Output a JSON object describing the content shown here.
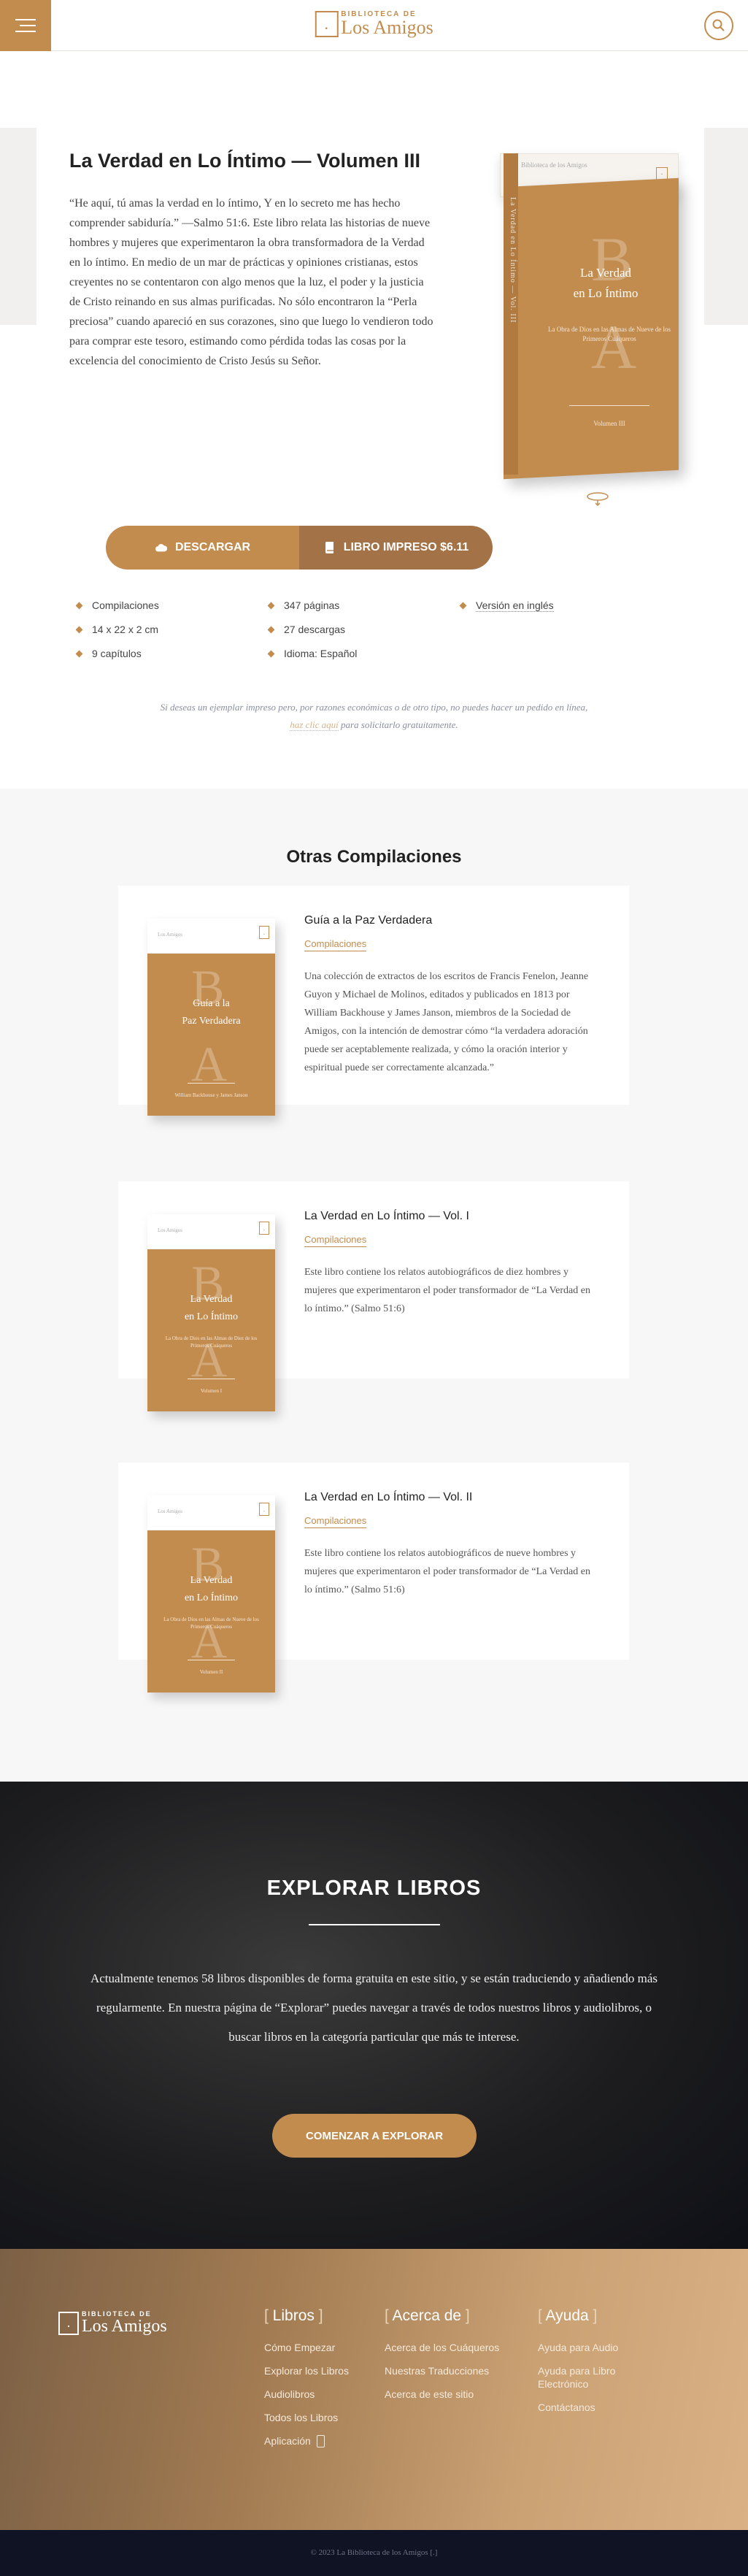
{
  "header": {
    "logo_small": "BIBLIOTECA DE",
    "logo_big": "Los Amigos",
    "logo_mark": "[.]",
    "icons": {
      "menu": "hamburger-icon",
      "search": "search-icon"
    }
  },
  "book": {
    "title": "La Verdad en Lo Íntimo — Volumen III",
    "description": "“He aquí, tú amas la verdad en lo íntimo, Y en lo secreto me has hecho comprender sabiduría.” —Salmo 51:6. Este libro relata las historias de nueve hombres y mujeres que experimentaron la obra transformadora de la Verdad en lo íntimo. En medio de un mar de prácticas y opiniones cristianas, estos creyentes no se contentaron con algo menos que la luz, el poder y la justicia de Cristo reinando en sus almas purificadas. No sólo encontraron la “Perla preciosa” cuando apareció en sus corazones, sino que luego lo vendieron todo para comprar este tesoro, estimando como pérdida todas las cosas por la excelencia del conocimiento de Cristo Jesús su Señor.",
    "cover": {
      "back_text": "Biblioteca de los Amigos",
      "spine": "La Verdad en Lo Íntimo — Vol. III",
      "letter_b": "B",
      "letter_a": "A",
      "title_line1": "La Verdad",
      "title_line2": "en Lo Íntimo",
      "subtitle": "La Obra de Dios en las Almas de Nueve de los Primeros Cuáqueros",
      "volume": "Volumen III"
    },
    "buttons": {
      "download": "DESCARGAR",
      "print": "LIBRO IMPRESO $6.11"
    },
    "meta": [
      "Compilaciones",
      "347 páginas",
      "Versión en inglés",
      "14 x 22 x 2 cm",
      "27 descargas",
      "9 capítulos",
      "Idioma: Español"
    ],
    "notice_before": "Si deseas un ejemplar impreso pero, por razones económicas o de otro tipo, no puedes hacer un pedido en línea,",
    "notice_link": "haz clic aquí",
    "notice_after": "para solicitarlo gratuitamente."
  },
  "related": {
    "title": "Otras Compilaciones",
    "items": [
      {
        "name": "Guía a la Paz Verdadera",
        "category": "Compilaciones",
        "cover_l1": "Guía a la",
        "cover_l2": "Paz Verdadera",
        "cover_sub": "",
        "cover_vol": "William Backhouse y James Janson",
        "description": "Una colección de extractos de los escritos de Francis Fenelon, Jeanne Guyon y Michael de Molinos, editados y publicados en 1813 por William Backhouse y James Janson, miembros de la Sociedad de Amigos, con la intención de demostrar cómo “la verdadera adoración puede ser aceptablemente realizada, y cómo la oración interior y espiritual puede ser correctamente alcanzada.”"
      },
      {
        "name": "La Verdad en Lo Íntimo — Vol. I",
        "category": "Compilaciones",
        "cover_l1": "La Verdad",
        "cover_l2": "en Lo Íntimo",
        "cover_sub": "La Obra de Dios en las Almas de Diez de los Primeros Cuáqueros",
        "cover_vol": "Volumen I",
        "description": "Este libro contiene los relatos autobiográficos de diez hombres y mujeres que experimentaron el poder transformador de “La Verdad en lo íntimo.” (Salmo 51:6)"
      },
      {
        "name": "La Verdad en Lo Íntimo — Vol. II",
        "category": "Compilaciones",
        "cover_l1": "La Verdad",
        "cover_l2": "en Lo Íntimo",
        "cover_sub": "La Obra de Dios en las Almas de Nueve de los Primeros Cuáqueros",
        "cover_vol": "Volumen II",
        "description": "Este libro contiene los relatos autobiográficos de nueve hombres y mujeres que experimentaron el poder transformador de “La Verdad en lo íntimo.” (Salmo 51:6)"
      }
    ]
  },
  "explore": {
    "title": "EXPLORAR LIBROS",
    "text": "Actualmente tenemos 58 libros disponibles de forma gratuita en este sitio, y se están traduciendo y añadiendo más regularmente. En nuestra página de “Explorar” puedes navegar a través de todos nuestros libros y audiolibros, o buscar libros en la categoría particular que más te interese.",
    "button": "COMENZAR A EXPLORAR"
  },
  "footer": {
    "cols": [
      {
        "title": "Libros",
        "links": [
          "Cómo Empezar",
          "Explorar los Libros",
          "Audiolibros",
          "Todos los Libros",
          "Aplicación"
        ]
      },
      {
        "title": "Acerca de",
        "links": [
          "Acerca de los Cuáqueros",
          "Nuestras Traducciones",
          "Acerca de este sitio"
        ]
      },
      {
        "title": "Ayuda",
        "links": [
          "Ayuda para Audio",
          "Ayuda para Libro Electrónico",
          "Contáctanos"
        ]
      }
    ],
    "copyright": "© 2023 La Biblioteca de los Amigos [.]"
  },
  "colors": {
    "accent": "#c38c4f",
    "accent_dark": "#a37347",
    "dark": "#101324"
  }
}
